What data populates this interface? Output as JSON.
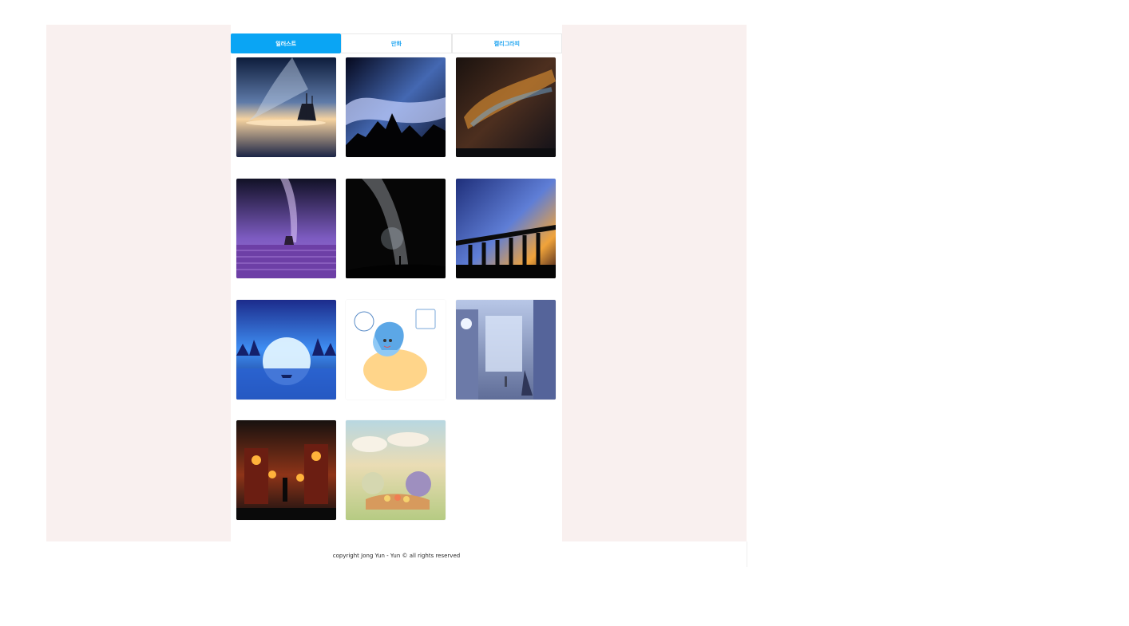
{
  "tabs": [
    {
      "label": "일러스트"
    },
    {
      "label": "만화"
    },
    {
      "label": "캘리그라피"
    }
  ],
  "footer": {
    "copyright": "copyright Jong Yun - Yun © all rights reserved"
  },
  "colors": {
    "accent": "#0aa5f4",
    "panel": "#f9f0ef"
  },
  "gallery": [
    {
      "icon": "starry-ship-illustration"
    },
    {
      "icon": "galaxy-mountain-illustration"
    },
    {
      "icon": "colorful-galaxy-illustration"
    },
    {
      "icon": "lavender-galaxy-illustration"
    },
    {
      "icon": "silhouette-galaxy-illustration"
    },
    {
      "icon": "bridge-sunset-illustration"
    },
    {
      "icon": "moon-lake-illustration"
    },
    {
      "icon": "cartoon-character-illustration"
    },
    {
      "icon": "city-street-illustration"
    },
    {
      "icon": "night-lantern-illustration"
    },
    {
      "icon": "picnic-field-illustration"
    }
  ]
}
